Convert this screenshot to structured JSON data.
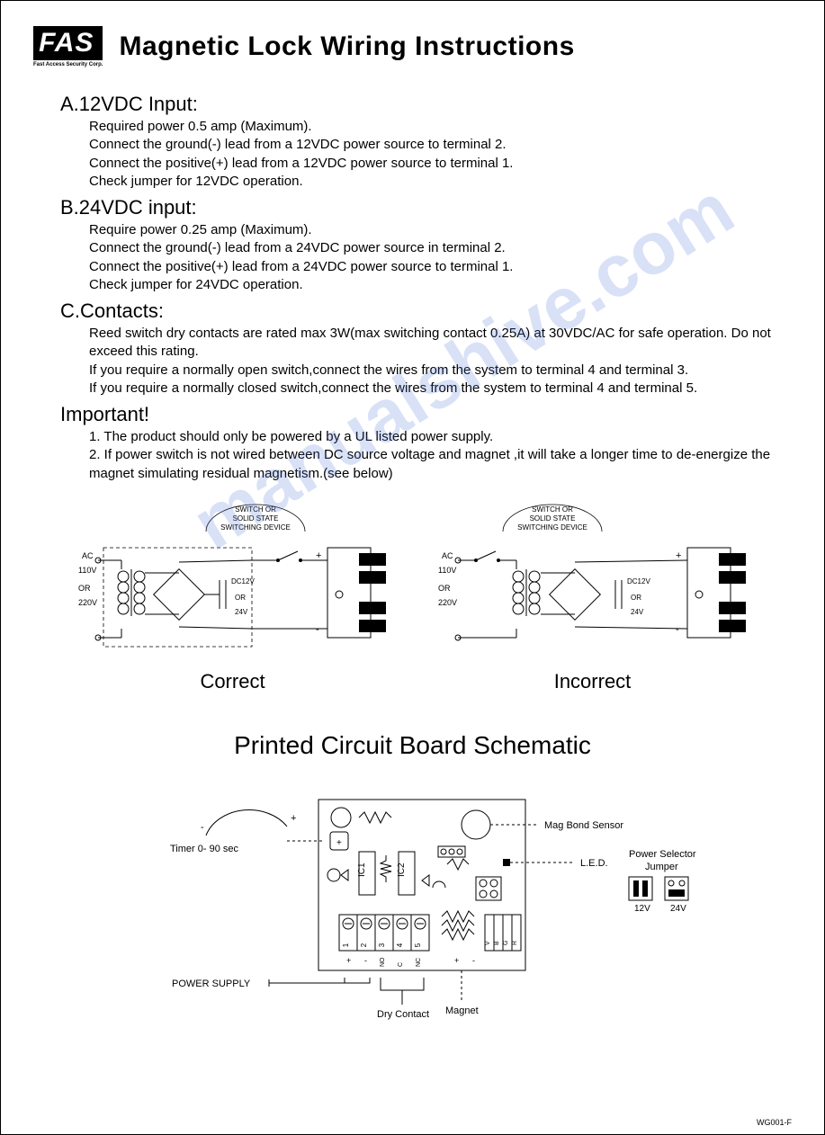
{
  "logo": {
    "text": "FAS",
    "subtitle": "Fast Access Security Corp."
  },
  "title": "Magnetic Lock Wiring Instructions",
  "sectionA": {
    "heading": "A.12VDC Input:",
    "lines": [
      "Required power 0.5 amp (Maximum).",
      "Connect the ground(-) lead from a 12VDC power source to terminal 2.",
      "Connect the positive(+) lead from a 12VDC power source to terminal 1.",
      "Check jumper for 12VDC operation."
    ]
  },
  "sectionB": {
    "heading": "B.24VDC input:",
    "lines": [
      "Require power 0.25 amp (Maximum).",
      "Connect the ground(-) lead from a 24VDC power source in terminal 2.",
      "Connect the positive(+) lead from a 24VDC power source to terminal 1.",
      "Check jumper for 24VDC operation."
    ]
  },
  "sectionC": {
    "heading": "C.Contacts:",
    "lines": [
      "Reed switch dry contacts are rated max 3W(max switching contact 0.25A) at 30VDC/AC for safe operation. Do not exceed this rating.",
      "If you require a normally open switch,connect the wires from the system to terminal 4 and terminal 3.",
      "If you require a normally closed switch,connect the wires from the system to terminal 4 and terminal 5."
    ]
  },
  "important": {
    "heading": "Important!",
    "lines": [
      "1. The product should only be powered by a UL listed power supply.",
      "2. If power switch is not wired between DC source voltage and magnet ,it will take a longer time to de-energize the magnet simulating residual magnetism.(see below)"
    ]
  },
  "wiringDiagram": {
    "switchLabel1": "SWITCH OR",
    "switchLabel2": "SOLID STATE",
    "switchLabel3": "SWITCHING DEVICE",
    "ac": "AC",
    "v110": "110V",
    "or": "OR",
    "v220": "220V",
    "dc12": "DC12V",
    "orMid": "OR",
    "dc24": "24V",
    "plus": "+",
    "minus": "-",
    "correct": "Correct",
    "incorrect": "Incorrect"
  },
  "pcb": {
    "title": "Printed Circuit Board Schematic",
    "timer": "Timer 0- 90 sec",
    "magBond": "Mag Bond Sensor",
    "led": "L.E.D.",
    "powerSelector": "Power Selector",
    "jumper": "Jumper",
    "v12": "12V",
    "v24": "24V",
    "ic1": "IC1",
    "ic2": "IC2",
    "powerSupply": "POWER SUPPLY",
    "dryContact": "Dry Contact",
    "magnet": "Magnet",
    "term1": "1",
    "term2": "2",
    "term3": "3",
    "term4": "4",
    "term5": "5",
    "tplus": "+",
    "tminus": "-",
    "no": "NO",
    "c": "C",
    "nc": "NC",
    "v": "V",
    "b": "B",
    "g": "G",
    "r": "R"
  },
  "docCode": "WG001-F",
  "watermark": "manualshive.com"
}
